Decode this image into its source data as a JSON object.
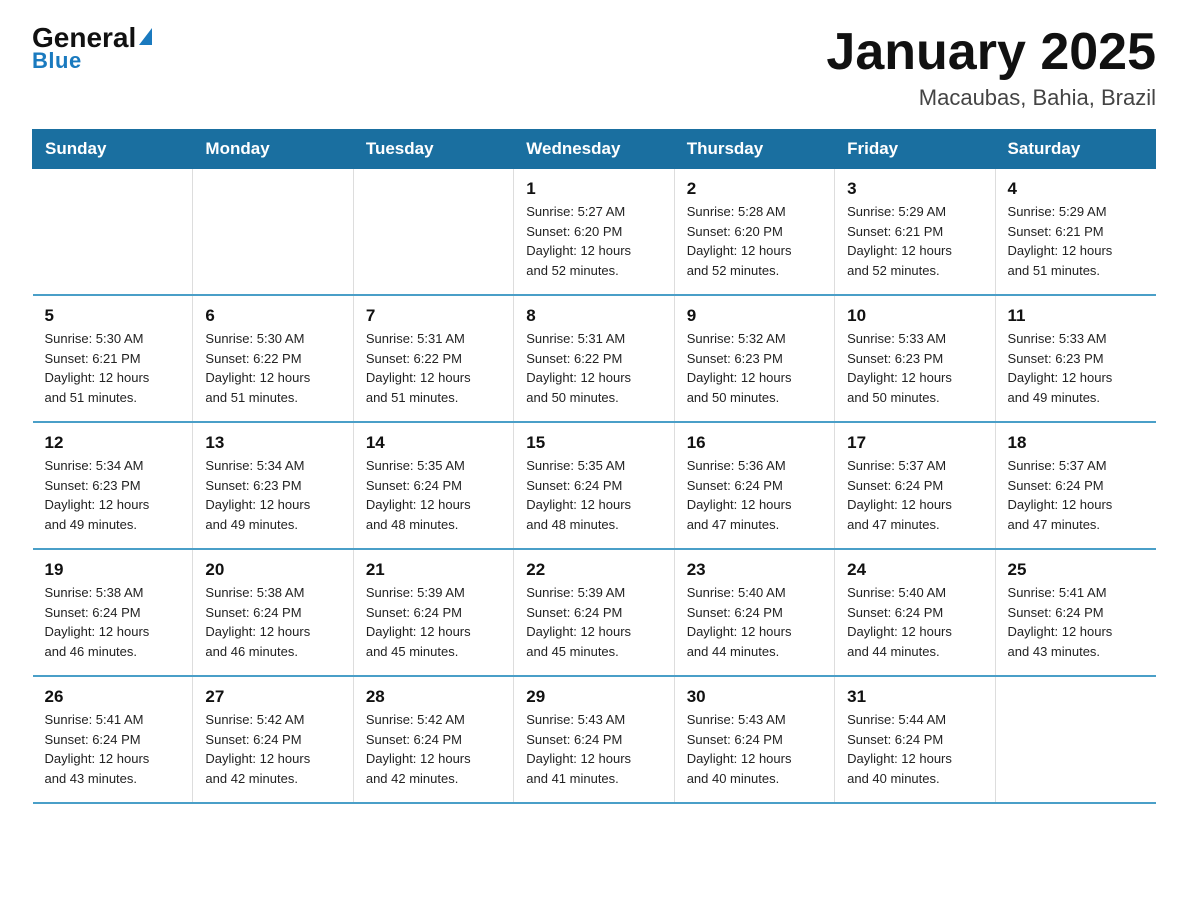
{
  "logo": {
    "text_general": "General",
    "text_blue": "Blue",
    "arrow_unicode": "▼"
  },
  "header": {
    "title": "January 2025",
    "subtitle": "Macaubas, Bahia, Brazil"
  },
  "weekdays": [
    "Sunday",
    "Monday",
    "Tuesday",
    "Wednesday",
    "Thursday",
    "Friday",
    "Saturday"
  ],
  "weeks": [
    [
      {
        "day": "",
        "info": ""
      },
      {
        "day": "",
        "info": ""
      },
      {
        "day": "",
        "info": ""
      },
      {
        "day": "1",
        "info": "Sunrise: 5:27 AM\nSunset: 6:20 PM\nDaylight: 12 hours\nand 52 minutes."
      },
      {
        "day": "2",
        "info": "Sunrise: 5:28 AM\nSunset: 6:20 PM\nDaylight: 12 hours\nand 52 minutes."
      },
      {
        "day": "3",
        "info": "Sunrise: 5:29 AM\nSunset: 6:21 PM\nDaylight: 12 hours\nand 52 minutes."
      },
      {
        "day": "4",
        "info": "Sunrise: 5:29 AM\nSunset: 6:21 PM\nDaylight: 12 hours\nand 51 minutes."
      }
    ],
    [
      {
        "day": "5",
        "info": "Sunrise: 5:30 AM\nSunset: 6:21 PM\nDaylight: 12 hours\nand 51 minutes."
      },
      {
        "day": "6",
        "info": "Sunrise: 5:30 AM\nSunset: 6:22 PM\nDaylight: 12 hours\nand 51 minutes."
      },
      {
        "day": "7",
        "info": "Sunrise: 5:31 AM\nSunset: 6:22 PM\nDaylight: 12 hours\nand 51 minutes."
      },
      {
        "day": "8",
        "info": "Sunrise: 5:31 AM\nSunset: 6:22 PM\nDaylight: 12 hours\nand 50 minutes."
      },
      {
        "day": "9",
        "info": "Sunrise: 5:32 AM\nSunset: 6:23 PM\nDaylight: 12 hours\nand 50 minutes."
      },
      {
        "day": "10",
        "info": "Sunrise: 5:33 AM\nSunset: 6:23 PM\nDaylight: 12 hours\nand 50 minutes."
      },
      {
        "day": "11",
        "info": "Sunrise: 5:33 AM\nSunset: 6:23 PM\nDaylight: 12 hours\nand 49 minutes."
      }
    ],
    [
      {
        "day": "12",
        "info": "Sunrise: 5:34 AM\nSunset: 6:23 PM\nDaylight: 12 hours\nand 49 minutes."
      },
      {
        "day": "13",
        "info": "Sunrise: 5:34 AM\nSunset: 6:23 PM\nDaylight: 12 hours\nand 49 minutes."
      },
      {
        "day": "14",
        "info": "Sunrise: 5:35 AM\nSunset: 6:24 PM\nDaylight: 12 hours\nand 48 minutes."
      },
      {
        "day": "15",
        "info": "Sunrise: 5:35 AM\nSunset: 6:24 PM\nDaylight: 12 hours\nand 48 minutes."
      },
      {
        "day": "16",
        "info": "Sunrise: 5:36 AM\nSunset: 6:24 PM\nDaylight: 12 hours\nand 47 minutes."
      },
      {
        "day": "17",
        "info": "Sunrise: 5:37 AM\nSunset: 6:24 PM\nDaylight: 12 hours\nand 47 minutes."
      },
      {
        "day": "18",
        "info": "Sunrise: 5:37 AM\nSunset: 6:24 PM\nDaylight: 12 hours\nand 47 minutes."
      }
    ],
    [
      {
        "day": "19",
        "info": "Sunrise: 5:38 AM\nSunset: 6:24 PM\nDaylight: 12 hours\nand 46 minutes."
      },
      {
        "day": "20",
        "info": "Sunrise: 5:38 AM\nSunset: 6:24 PM\nDaylight: 12 hours\nand 46 minutes."
      },
      {
        "day": "21",
        "info": "Sunrise: 5:39 AM\nSunset: 6:24 PM\nDaylight: 12 hours\nand 45 minutes."
      },
      {
        "day": "22",
        "info": "Sunrise: 5:39 AM\nSunset: 6:24 PM\nDaylight: 12 hours\nand 45 minutes."
      },
      {
        "day": "23",
        "info": "Sunrise: 5:40 AM\nSunset: 6:24 PM\nDaylight: 12 hours\nand 44 minutes."
      },
      {
        "day": "24",
        "info": "Sunrise: 5:40 AM\nSunset: 6:24 PM\nDaylight: 12 hours\nand 44 minutes."
      },
      {
        "day": "25",
        "info": "Sunrise: 5:41 AM\nSunset: 6:24 PM\nDaylight: 12 hours\nand 43 minutes."
      }
    ],
    [
      {
        "day": "26",
        "info": "Sunrise: 5:41 AM\nSunset: 6:24 PM\nDaylight: 12 hours\nand 43 minutes."
      },
      {
        "day": "27",
        "info": "Sunrise: 5:42 AM\nSunset: 6:24 PM\nDaylight: 12 hours\nand 42 minutes."
      },
      {
        "day": "28",
        "info": "Sunrise: 5:42 AM\nSunset: 6:24 PM\nDaylight: 12 hours\nand 42 minutes."
      },
      {
        "day": "29",
        "info": "Sunrise: 5:43 AM\nSunset: 6:24 PM\nDaylight: 12 hours\nand 41 minutes."
      },
      {
        "day": "30",
        "info": "Sunrise: 5:43 AM\nSunset: 6:24 PM\nDaylight: 12 hours\nand 40 minutes."
      },
      {
        "day": "31",
        "info": "Sunrise: 5:44 AM\nSunset: 6:24 PM\nDaylight: 12 hours\nand 40 minutes."
      },
      {
        "day": "",
        "info": ""
      }
    ]
  ]
}
